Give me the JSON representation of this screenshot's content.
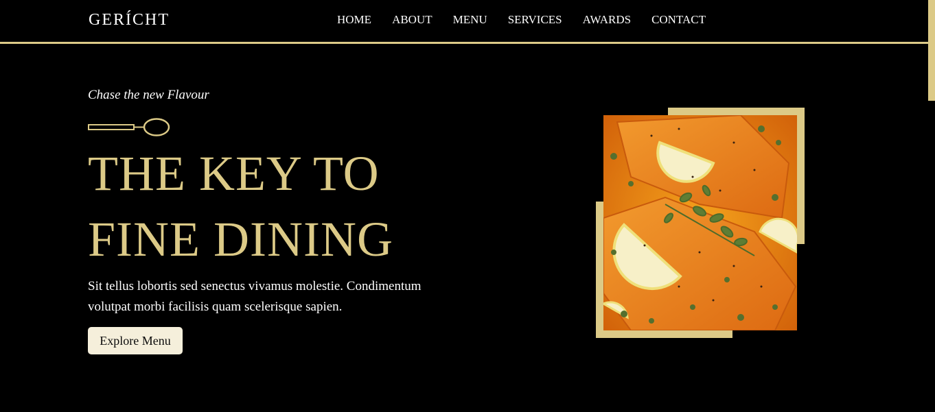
{
  "navbar": {
    "logo": "GERÍCHT",
    "links": [
      "HOME",
      "ABOUT",
      "MENU",
      "SERVICES",
      "AWARDS",
      "CONTACT"
    ]
  },
  "hero": {
    "subtitle": "Chase the new Flavour",
    "headline_line1": "THE KEY TO",
    "headline_line2": "FINE DINING",
    "description": "Sit tellus lobortis sed senectus vivamus molestie. Condimentum volutpat morbi facilisis quam scelerisque sapien.",
    "button_label": "Explore Menu",
    "image_alt": "Salmon with lemon and herbs"
  },
  "colors": {
    "background": "#000000",
    "accent_gold": "#dcca87",
    "text": "#ffffff",
    "button_bg": "#f5efdb"
  },
  "icons": [
    "spoon-icon"
  ]
}
